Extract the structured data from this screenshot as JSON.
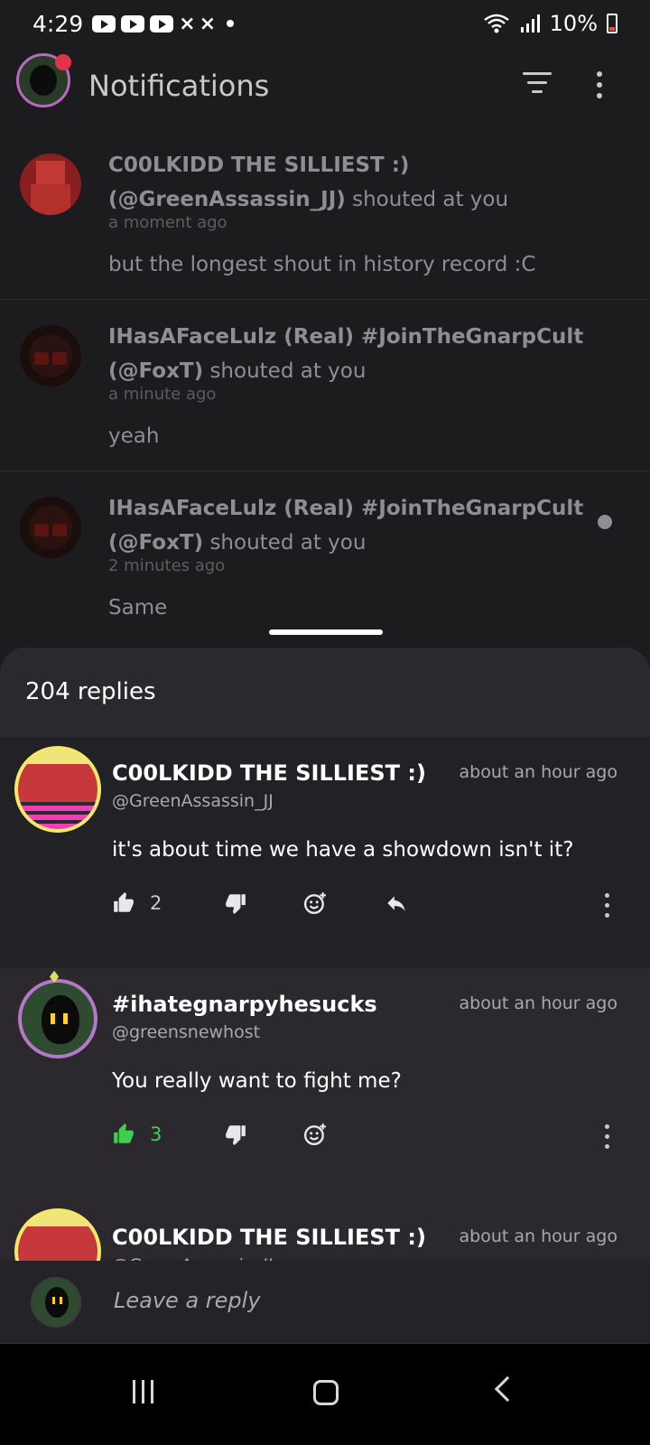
{
  "status_bar": {
    "time": "4:29",
    "battery": "10%",
    "icons": [
      "youtube-icon",
      "youtube-icon",
      "youtube-icon",
      "capcut-icon",
      "capcut-icon",
      "dot-icon",
      "wifi-icon",
      "signal-icon",
      "battery-icon"
    ]
  },
  "header": {
    "title": "Notifications",
    "icons": [
      "filter-icon",
      "more-vert-icon"
    ]
  },
  "notifications": [
    {
      "name": "C00LKIDD THE SILLIEST :)",
      "handle": "(@GreenAssassin_JJ)",
      "action": "shouted at you",
      "time": "a moment ago",
      "message": "but the longest shout in history record :C",
      "unread": false
    },
    {
      "name": "IHasAFaceLulz (Real) #JoinTheGnarpCult",
      "handle": "(@FoxT)",
      "action": "shouted at you",
      "time": "a minute ago",
      "message": "yeah",
      "unread": false
    },
    {
      "name": "IHasAFaceLulz (Real) #JoinTheGnarpCult",
      "handle": "(@FoxT)",
      "action": "shouted at you",
      "time": "2 minutes ago",
      "message": "Same",
      "unread": true
    }
  ],
  "sheet": {
    "title": "204 replies",
    "replies": [
      {
        "name": "C00LKIDD THE SILLIEST :)",
        "handle": "@GreenAssassin_JJ",
        "time": "about an hour ago",
        "body": "it's about time we have a showdown isn't it?",
        "likes": "2",
        "liked": false
      },
      {
        "name": "#ihategnarpyhesucks",
        "handle": "@greensnewhost",
        "time": "about an hour ago",
        "body": "You really want to fight me?",
        "likes": "3",
        "liked": true
      },
      {
        "name": "C00LKIDD THE SILLIEST :)",
        "handle": "@GreenAssassin_JJ",
        "time": "about an hour ago"
      }
    ],
    "composer_placeholder": "Leave a reply"
  },
  "colors": {
    "background": "#1c1b1e",
    "sheet": "#2b292e",
    "liked_green": "#3ecf4e",
    "muted_text": "#8f8e94"
  }
}
